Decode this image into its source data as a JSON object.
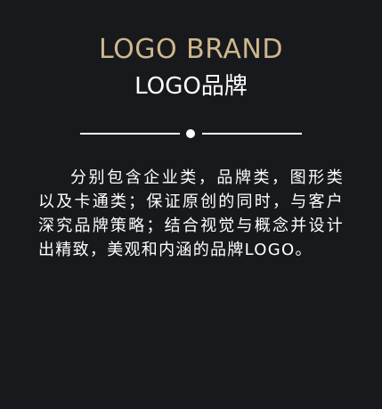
{
  "brand": {
    "title_en": "LOGO BRAND",
    "title_cn": "LOGO品牌"
  },
  "description": "分别包含企业类，品牌类，图形类以及卡通类；保证原创的同时，与客户深究品牌策略；结合视觉与概念并设计出精致，美观和内涵的品牌LOGO。",
  "colors": {
    "background": "#18191d",
    "accent_gold": "#cdb78c",
    "text": "#ffffff"
  }
}
